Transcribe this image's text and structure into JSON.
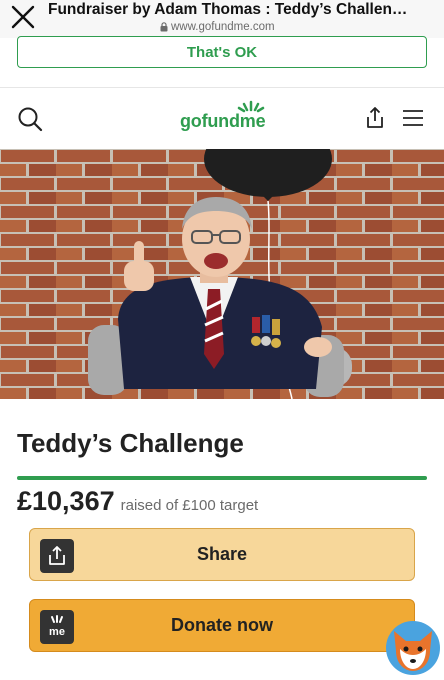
{
  "browser": {
    "title": "Fundraiser by Adam Thomas : Teddy’s Challen…",
    "url": "www.gofundme.com"
  },
  "cookie": {
    "ok_label": "That's OK"
  },
  "header": {
    "logo_text": "gofundme"
  },
  "campaign": {
    "title": "Teddy’s Challenge",
    "amount_raised": "£10,367",
    "raised_of_text": "raised of £100 target",
    "progress_fraction": 1.0
  },
  "actions": {
    "share_label": "Share",
    "donate_label": "Donate now",
    "donate_icon_text": "me"
  },
  "colors": {
    "brand_green": "#2f9d4f",
    "share_button": "#f7d79a",
    "donate_button": "#f0aa35"
  },
  "icons": [
    "close-icon",
    "lock-icon",
    "search-icon",
    "share-icon",
    "menu-icon",
    "gofundme-me-icon",
    "fox-icon"
  ]
}
